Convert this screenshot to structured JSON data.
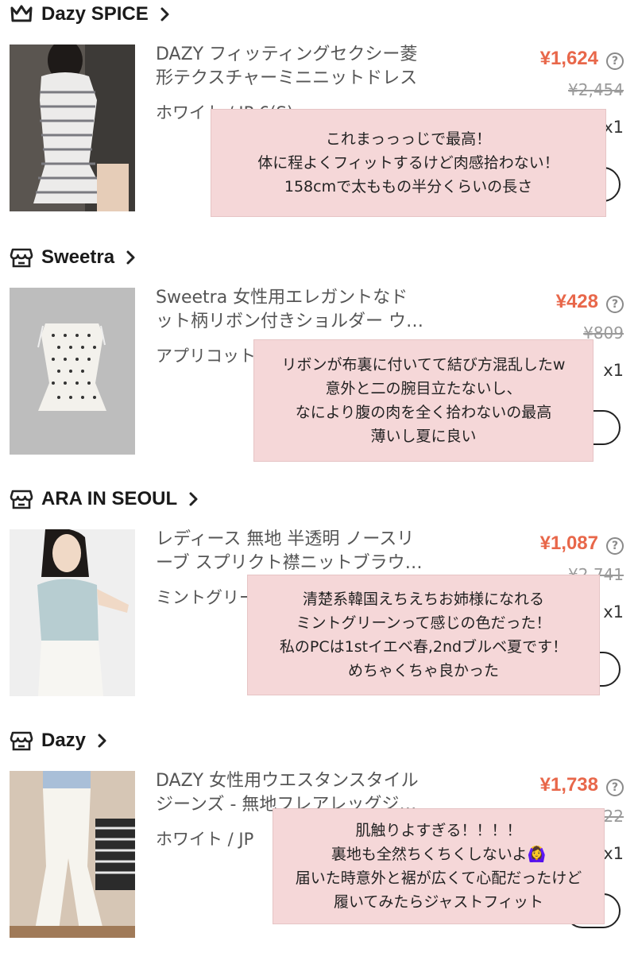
{
  "stores": [
    {
      "name": "Dazy SPICE",
      "store_icon": "crown-store-icon",
      "product": {
        "title": "DAZY フィッティングセクシー菱\n形テクスチャーミニニットドレス",
        "variant": "ホワイト / JP 6(S)",
        "price": "¥1,624",
        "original_price": "¥2,454",
        "quantity": "x1"
      },
      "note": {
        "lines": [
          "これまっっっじで最高！",
          "体に程よくフィットするけど肉感拾わない！",
          "158cmで太ももの半分くらいの長さ"
        ]
      }
    },
    {
      "name": "Sweetra",
      "store_icon": "storefront-icon",
      "product": {
        "title": "Sweetra 女性用エレガントなド\nット柄リボン付きショルダー ウ…",
        "variant": "アプリコット",
        "price": "¥428",
        "original_price": "¥809",
        "quantity": "x1"
      },
      "note": {
        "lines": [
          "リボンが布裏に付いてて結び方混乱したw",
          "意外と二の腕目立たないし、",
          "なにより腹の肉を全く拾わないの最高",
          "薄いし夏に良い"
        ]
      }
    },
    {
      "name": "ARA IN SEOUL",
      "store_icon": "storefront-icon",
      "product": {
        "title": "レディース 無地 半透明 ノースリ\nーブ スプリクト襟ニットブラウ…",
        "variant": "ミントグリーン",
        "price": "¥1,087",
        "original_price": "¥2,741",
        "quantity": "x1"
      },
      "note": {
        "lines": [
          "清楚系韓国えちえちお姉様になれる",
          "ミントグリーンって感じの色だった！",
          "私のPCは1stイエベ春,2ndブルベ夏です！",
          "めちゃくちゃ良かった"
        ]
      }
    },
    {
      "name": "Dazy",
      "store_icon": "storefront-icon",
      "product": {
        "title": "DAZY 女性用ウエスタンスタイル\nジーンズ - 無地フレアレッグジ…",
        "variant": "ホワイト / JP",
        "price": "¥1,738",
        "original_price": "¥3,622",
        "quantity": "x1"
      },
      "note": {
        "lines": [
          "肌触りよすぎる！！！！",
          "裏地も全然ちくちくしないよ🙆‍♀️",
          "届いた時意外と裾が広くて心配だったけど",
          "履いてみたらジャストフィット"
        ]
      }
    }
  ],
  "colors": {
    "price": "#e8674a",
    "note_bg": "#f5d7d8",
    "muted": "#9a9a9a"
  }
}
